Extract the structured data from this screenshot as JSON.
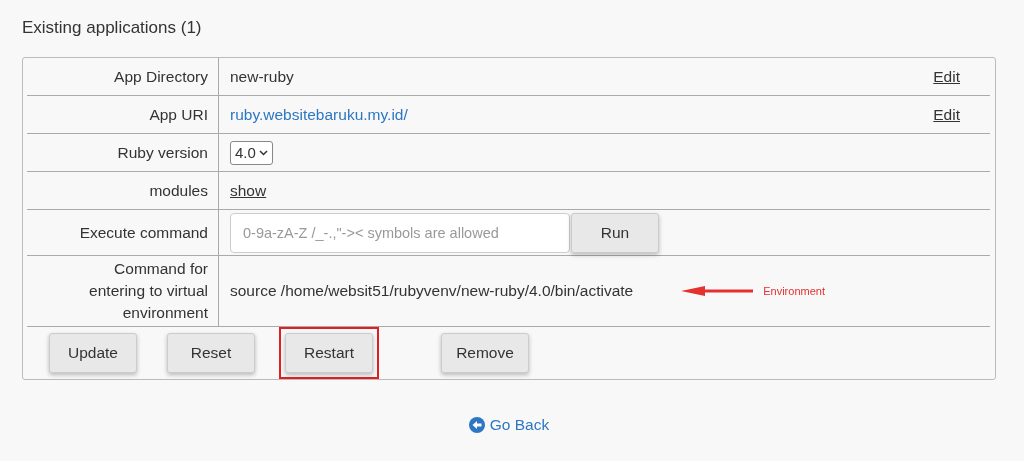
{
  "heading": "Existing applications (1)",
  "rows": [
    {
      "kind": "text",
      "label": "App Directory",
      "value": "new-ruby",
      "action": "Edit"
    },
    {
      "kind": "link",
      "label": "App URI",
      "value": "ruby.websitebaruku.my.id/",
      "action": "Edit"
    },
    {
      "kind": "select",
      "label": "Ruby version",
      "value": "4.0"
    },
    {
      "kind": "toggle",
      "label": "modules",
      "value": "show"
    },
    {
      "kind": "command",
      "label": "Execute command",
      "placeholder": "0-9a-zA-Z /_-.,\"->< symbols are allowed",
      "button": "Run"
    },
    {
      "kind": "text",
      "label": "Command for entering to virtual environment",
      "value": "source /home/websit51/rubyvenv/new-ruby/4.0/bin/activate",
      "annotation": "Environment"
    }
  ],
  "buttons": [
    {
      "label": "Update",
      "highlighted": false
    },
    {
      "label": "Reset",
      "highlighted": false
    },
    {
      "label": "Restart",
      "highlighted": true
    },
    {
      "label": "Remove",
      "highlighted": false
    }
  ],
  "back_link": "Go Back"
}
